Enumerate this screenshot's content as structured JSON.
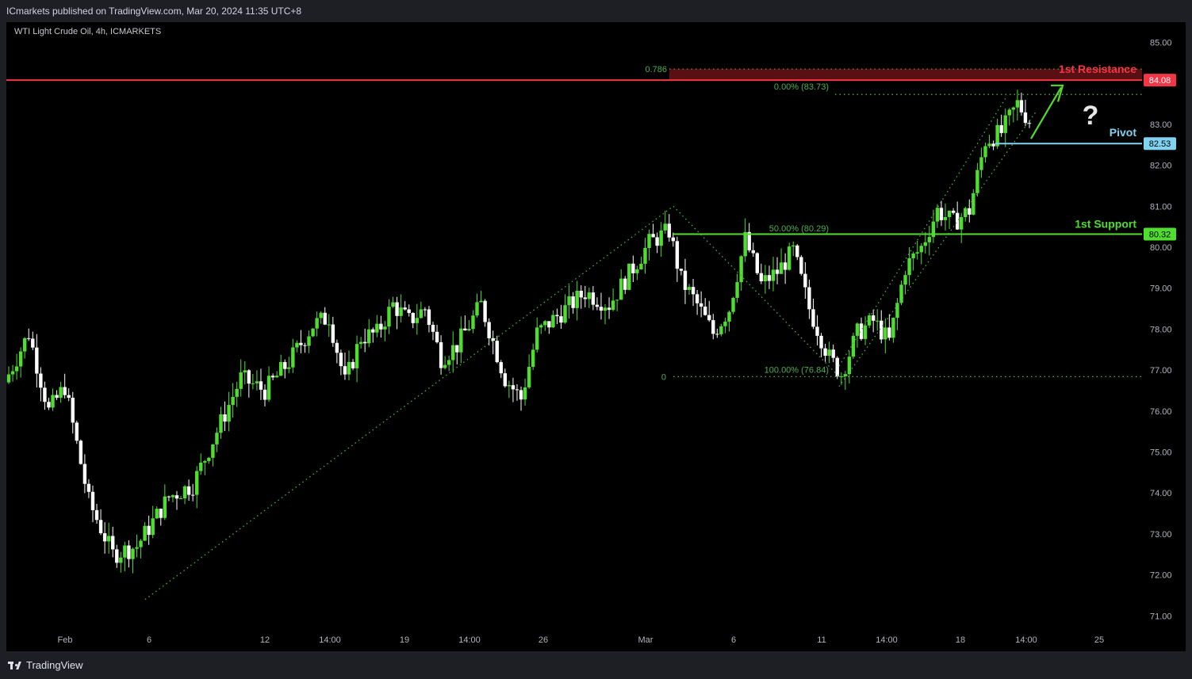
{
  "header": {
    "published": "ICmarkets published on TradingView.com, Mar 20, 2024 11:35 UTC+8"
  },
  "symbol": {
    "title": "WTI Light Crude Oil, 4h, ICMARKETS"
  },
  "footer": {
    "brand": "TradingView"
  },
  "colors": {
    "up": "#4fde2f",
    "down": "#ffffff",
    "resistance": "#f23645",
    "support": "#4fde2f",
    "pivot": "#7fd3f0",
    "fib": "#4caf50"
  },
  "chart_data": {
    "type": "candlestick",
    "timeframe": "4h",
    "ylim": [
      70.6,
      85.3
    ],
    "y_ticks": [
      "85.00",
      "84.00",
      "83.00",
      "82.00",
      "81.00",
      "80.00",
      "79.00",
      "78.00",
      "77.00",
      "76.00",
      "75.00",
      "74.00",
      "73.00",
      "72.00",
      "71.00"
    ],
    "x_ticks": [
      "Feb",
      "6",
      "12",
      "14:00",
      "19",
      "14:00",
      "26",
      "Mar",
      "6",
      "11",
      "14:00",
      "18",
      "14:00",
      "25"
    ],
    "levels": [
      {
        "name": "1st Resistance",
        "value": 84.08,
        "price_label": "84.08",
        "color": "#f23645"
      },
      {
        "name": "Pivot",
        "value": 82.53,
        "price_label": "82.53",
        "color": "#7fd3f0"
      },
      {
        "name": "1st Support",
        "value": 80.32,
        "price_label": "80.32",
        "color": "#4fde2f"
      }
    ],
    "fibonacci": [
      {
        "label": "0.786",
        "value": 84.35
      },
      {
        "label": "0.00% (83.73)",
        "value": 83.73
      },
      {
        "label": "50.00% (80.29)",
        "value": 80.29
      },
      {
        "label": "100.00% (76.84)",
        "value": 76.84
      },
      {
        "label": "0",
        "value": 76.84
      }
    ],
    "annotations": [
      "?"
    ],
    "anchor_points": [
      {
        "bar": 0,
        "close": 76.9
      },
      {
        "bar": 5,
        "close": 77.9
      },
      {
        "bar": 10,
        "close": 76.0
      },
      {
        "bar": 14,
        "close": 76.6
      },
      {
        "bar": 20,
        "close": 73.8
      },
      {
        "bar": 26,
        "close": 72.5
      },
      {
        "bar": 32,
        "close": 72.7
      },
      {
        "bar": 40,
        "close": 73.9
      },
      {
        "bar": 46,
        "close": 74.2
      },
      {
        "bar": 52,
        "close": 75.5
      },
      {
        "bar": 58,
        "close": 76.8
      },
      {
        "bar": 64,
        "close": 76.5
      },
      {
        "bar": 70,
        "close": 77.2
      },
      {
        "bar": 76,
        "close": 78.1
      },
      {
        "bar": 80,
        "close": 78.3
      },
      {
        "bar": 84,
        "close": 76.7
      },
      {
        "bar": 88,
        "close": 77.8
      },
      {
        "bar": 92,
        "close": 77.9
      },
      {
        "bar": 96,
        "close": 78.6
      },
      {
        "bar": 100,
        "close": 78.2
      },
      {
        "bar": 104,
        "close": 78.5
      },
      {
        "bar": 108,
        "close": 77.3
      },
      {
        "bar": 112,
        "close": 77.6
      },
      {
        "bar": 118,
        "close": 78.6
      },
      {
        "bar": 124,
        "close": 76.8
      },
      {
        "bar": 128,
        "close": 76.3
      },
      {
        "bar": 132,
        "close": 77.9
      },
      {
        "bar": 138,
        "close": 78.4
      },
      {
        "bar": 144,
        "close": 78.9
      },
      {
        "bar": 150,
        "close": 78.6
      },
      {
        "bar": 156,
        "close": 79.5
      },
      {
        "bar": 160,
        "close": 80.1
      },
      {
        "bar": 165,
        "close": 80.4
      },
      {
        "bar": 168,
        "close": 79.2
      },
      {
        "bar": 172,
        "close": 78.6
      },
      {
        "bar": 176,
        "close": 77.9
      },
      {
        "bar": 180,
        "close": 78.5
      },
      {
        "bar": 184,
        "close": 80.2
      },
      {
        "bar": 188,
        "close": 79.1
      },
      {
        "bar": 192,
        "close": 79.4
      },
      {
        "bar": 196,
        "close": 79.9
      },
      {
        "bar": 200,
        "close": 78.5
      },
      {
        "bar": 205,
        "close": 77.3
      },
      {
        "bar": 208,
        "close": 76.9
      },
      {
        "bar": 212,
        "close": 77.9
      },
      {
        "bar": 216,
        "close": 78.2
      },
      {
        "bar": 220,
        "close": 77.7
      },
      {
        "bar": 224,
        "close": 79.5
      },
      {
        "bar": 228,
        "close": 80.0
      },
      {
        "bar": 232,
        "close": 80.9
      },
      {
        "bar": 236,
        "close": 80.6
      },
      {
        "bar": 240,
        "close": 80.9
      },
      {
        "bar": 244,
        "close": 82.6
      },
      {
        "bar": 248,
        "close": 82.8
      },
      {
        "bar": 252,
        "close": 83.5
      },
      {
        "bar": 255,
        "close": 83.1
      }
    ]
  }
}
